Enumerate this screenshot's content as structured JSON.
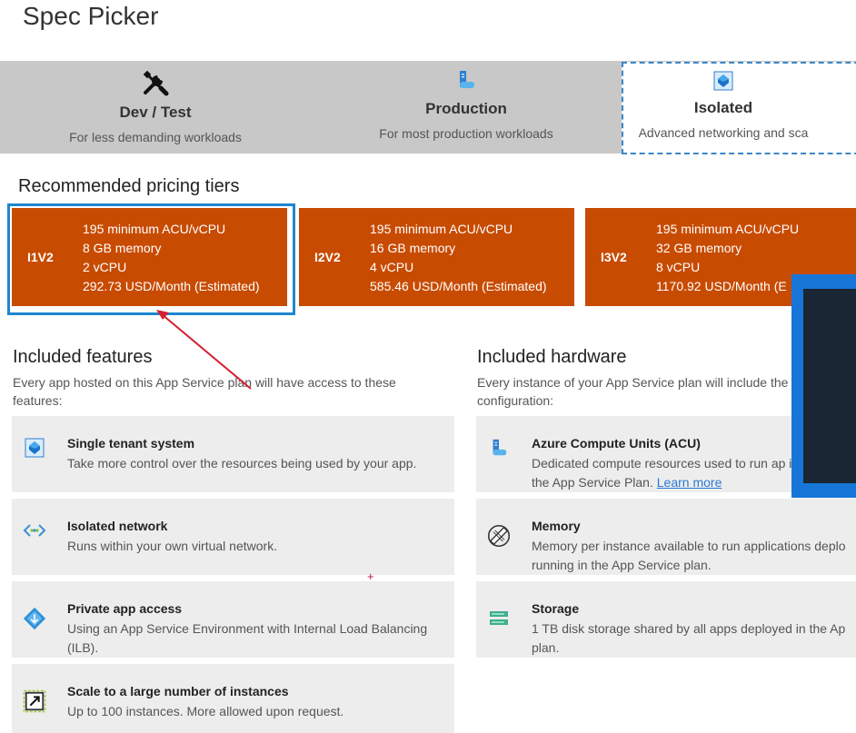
{
  "page": {
    "title": "Spec Picker"
  },
  "tabs": [
    {
      "name": "Dev / Test",
      "desc": "For less demanding workloads",
      "icon": "tools-icon"
    },
    {
      "name": "Production",
      "desc": "For most production workloads",
      "icon": "server-icon"
    },
    {
      "name": "Isolated",
      "desc": "Advanced networking and sca",
      "icon": "isolated-icon",
      "selected": true
    }
  ],
  "pricing": {
    "heading": "Recommended pricing tiers",
    "tiers": [
      {
        "code": "I1V2",
        "acu": "195 minimum ACU/vCPU",
        "memory": "8 GB memory",
        "vcpu": "2 vCPU",
        "price": "292.73 USD/Month (Estimated)",
        "selected": true
      },
      {
        "code": "I2V2",
        "acu": "195 minimum ACU/vCPU",
        "memory": "16 GB memory",
        "vcpu": "4 vCPU",
        "price": "585.46 USD/Month (Estimated)"
      },
      {
        "code": "I3V2",
        "acu": "195 minimum ACU/vCPU",
        "memory": "32 GB memory",
        "vcpu": "8 vCPU",
        "price": "1170.92 USD/Month (E"
      }
    ]
  },
  "features": {
    "heading": "Included features",
    "desc": "Every app hosted on this App Service plan will have access to these features:",
    "items": [
      {
        "title": "Single tenant system",
        "desc": "Take more control over the resources being used by your app.",
        "icon": "single-tenant-icon"
      },
      {
        "title": "Isolated network",
        "desc": "Runs within your own virtual network.",
        "icon": "network-icon"
      },
      {
        "title": "Private app access",
        "desc": "Using an App Service Environment with Internal Load Balancing (ILB).",
        "icon": "private-access-icon"
      },
      {
        "title": "Scale to a large number of instances",
        "desc": "Up to 100 instances. More allowed upon request.",
        "icon": "scale-icon"
      }
    ]
  },
  "hardware": {
    "heading": "Included hardware",
    "desc": "Every instance of your App Service plan will include the configuration:",
    "items": [
      {
        "title": "Azure Compute Units (ACU)",
        "desc": "Dedicated compute resources used to run ap in the App Service Plan.",
        "link": "Learn more",
        "icon": "compute-icon"
      },
      {
        "title": "Memory",
        "desc": "Memory per instance available to run applications deplo running in the App Service plan.",
        "icon": "memory-icon"
      },
      {
        "title": "Storage",
        "desc": "1 TB disk storage shared by all apps deployed in the Ap plan.",
        "icon": "storage-icon"
      }
    ]
  },
  "colors": {
    "tier_bg": "#c84b02",
    "selected_outline": "#1f86d0",
    "arrow": "#d42031"
  }
}
